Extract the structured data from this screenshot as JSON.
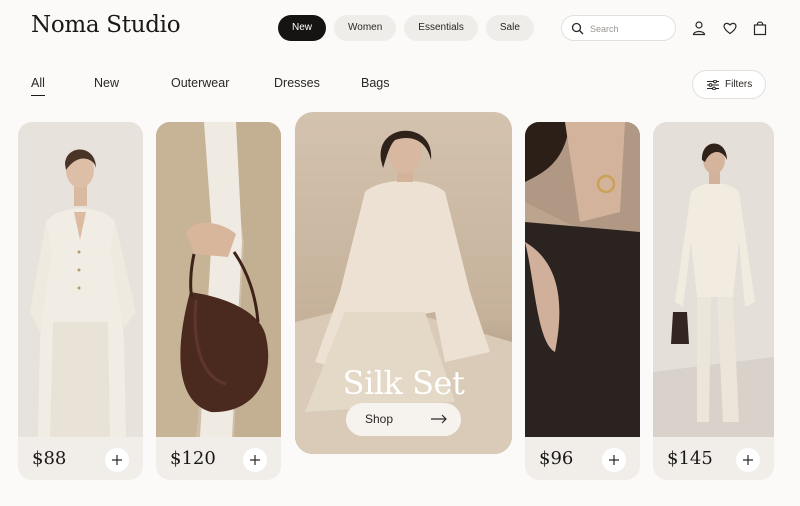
{
  "brand": "Noma Studio",
  "nav_pills": [
    {
      "label": "New",
      "active": true
    },
    {
      "label": "Women",
      "active": false
    },
    {
      "label": "Essentials",
      "active": false
    },
    {
      "label": "Sale",
      "active": false
    }
  ],
  "search": {
    "placeholder": "Search",
    "value": ""
  },
  "header_icons": [
    "account-icon",
    "heart-icon",
    "bag-icon"
  ],
  "categories": [
    {
      "label": "All",
      "active": true
    },
    {
      "label": "New",
      "active": false
    },
    {
      "label": "Outerwear",
      "active": false
    },
    {
      "label": "Dresses",
      "active": false
    },
    {
      "label": "Bags",
      "active": false
    }
  ],
  "filters_label": "Filters",
  "products": [
    {
      "price": "$88"
    },
    {
      "price": "$120"
    },
    {
      "price": "$96"
    },
    {
      "price": "$145"
    }
  ],
  "feature": {
    "title": "Silk Set",
    "cta": "Shop"
  },
  "colors": {
    "accent": "#151412",
    "card": "#f1eeea",
    "background": "#fbfaf8"
  }
}
